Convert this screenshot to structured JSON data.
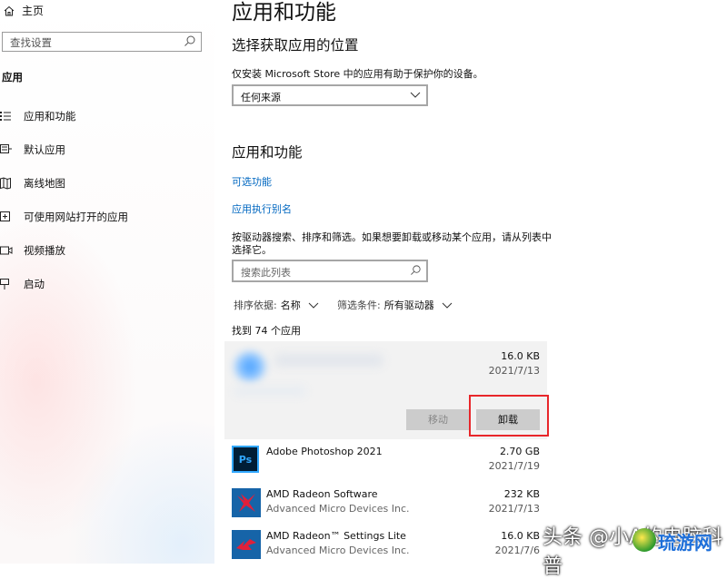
{
  "sidebar": {
    "home_label": "主页",
    "search_placeholder": "查找设置",
    "section_label": "应用",
    "items": [
      {
        "label": "应用和功能",
        "icon": "list-icon"
      },
      {
        "label": "默认应用",
        "icon": "default-apps-icon"
      },
      {
        "label": "离线地图",
        "icon": "map-icon"
      },
      {
        "label": "可使用网站打开的应用",
        "icon": "open-website-icon"
      },
      {
        "label": "视频播放",
        "icon": "video-icon"
      },
      {
        "label": "启动",
        "icon": "startup-icon"
      }
    ]
  },
  "main": {
    "title": "应用和功能",
    "location_heading": "选择获取应用的位置",
    "location_desc": "仅安装 Microsoft Store 中的应用有助于保护你的设备。",
    "location_value": "任何来源",
    "apps_heading": "应用和功能",
    "link_optional": "可选功能",
    "link_alias": "应用执行别名",
    "search_desc_line1": "按驱动器搜索、排序和筛选。如果想要卸载或移动某个应用，请从列表中",
    "search_desc_line2": "选择它。",
    "search_placeholder": "搜索此列表",
    "sort_label": "排序依据:",
    "sort_value": "名称",
    "filter_label": "筛选条件:",
    "filter_value": "所有驱动器",
    "found_text": "找到 74 个应用",
    "selected_app": {
      "size": "16.0 KB",
      "date": "2021/7/13",
      "move_label": "移动",
      "uninstall_label": "卸载"
    },
    "apps": [
      {
        "name": "Adobe Photoshop 2021",
        "publisher": "",
        "size": "2.70 GB",
        "date": "2021/7/19",
        "icon": "photoshop-icon",
        "icon_text": "Ps",
        "color": "#001e36"
      },
      {
        "name": "AMD Radeon Software",
        "publisher": "Advanced Micro Devices Inc.",
        "size": "232 KB",
        "date": "2021/7/13",
        "icon": "amd-radeon-icon",
        "color": "#1664a8"
      },
      {
        "name": "AMD Radeon™ Settings Lite",
        "publisher": "Advanced Micro Devices Inc.",
        "size": "16.0 KB",
        "date": "2021/7/6",
        "icon": "amd-radeon-icon",
        "color": "#1664a8"
      }
    ]
  },
  "watermark": {
    "text": "头条 @小A的电脑科普",
    "site": "琉游网"
  },
  "colors": {
    "link": "#0067c0",
    "highlight": "#e8262a",
    "selected_bg": "#f2f2f2"
  }
}
